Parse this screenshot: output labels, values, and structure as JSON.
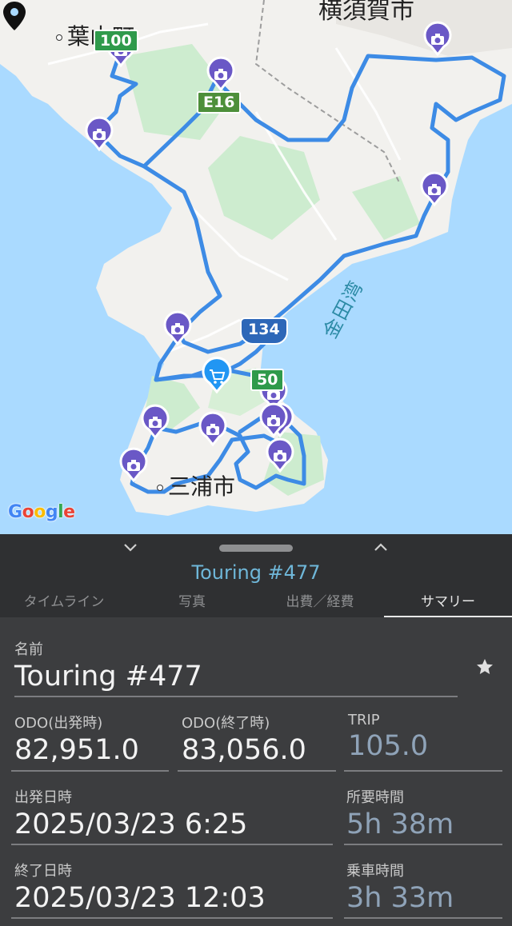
{
  "map": {
    "labels": {
      "hayama": "葉山町",
      "yokosuka": "横須賀市",
      "miura": "三浦市",
      "bay": "金田湾"
    },
    "shields": {
      "r100": "100",
      "e16": "E16",
      "r134": "134",
      "r50": "50"
    },
    "google_logo": {
      "g1": "G",
      "o1": "o",
      "o2": "o",
      "g2": "g",
      "l": "l",
      "e": "e"
    },
    "colors": {
      "sea": "#aadaff",
      "land": "#f2f1ee",
      "park": "#cdeccf",
      "route": "#3d8be5",
      "marker": "#6a58c6"
    }
  },
  "sheet": {
    "title": "Touring #477",
    "tabs": [
      "タイムライン",
      "写真",
      "出費／経費",
      "サマリー"
    ],
    "active_tab": "サマリー",
    "name_label": "名前",
    "name_value": "Touring #477",
    "odo_start_label": "ODO(出発時)",
    "odo_start_value": "82,951.0",
    "odo_end_label": "ODO(終了時)",
    "odo_end_value": "83,056.0",
    "trip_label": "TRIP",
    "trip_value": "105.0",
    "depart_label": "出発日時",
    "depart_value": "2025/03/23 6:25",
    "duration_label": "所要時間",
    "duration_value": "5h 38m",
    "end_label": "終了日時",
    "end_value": "2025/03/23 12:03",
    "ride_label": "乗車時間",
    "ride_value": "3h 33m"
  }
}
